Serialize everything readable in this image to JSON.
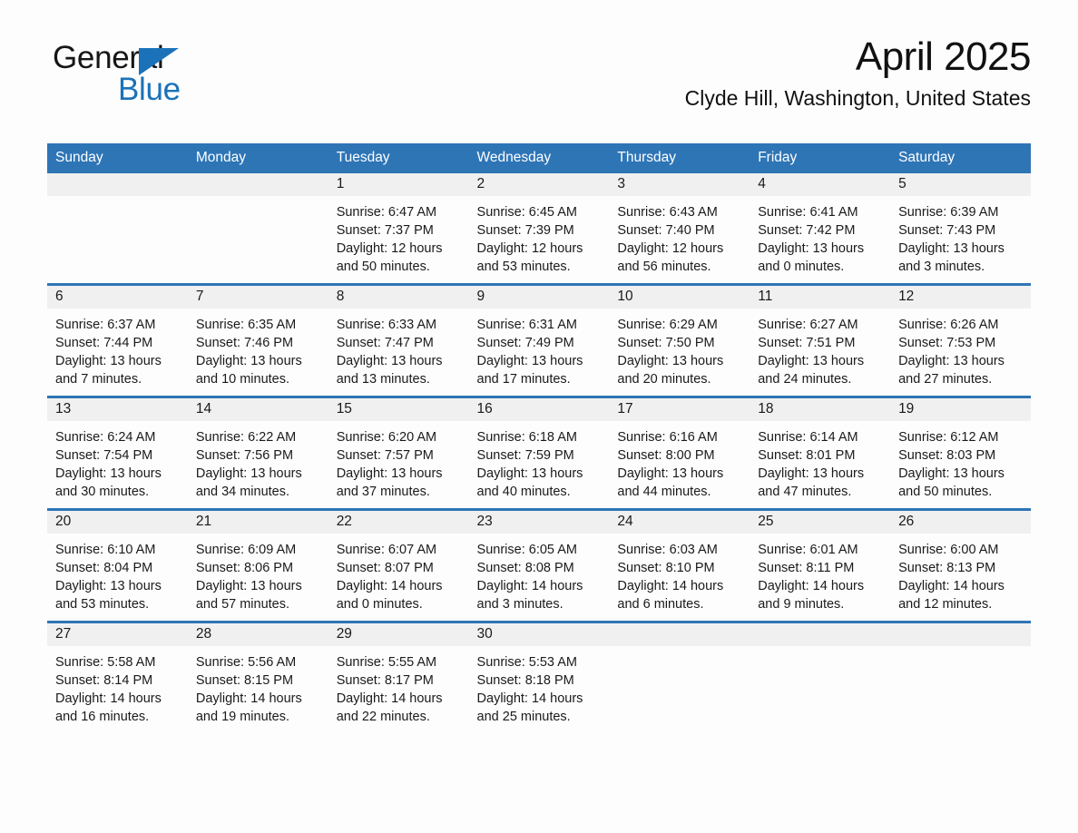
{
  "logo": {
    "word_one": "General",
    "word_two": "Blue",
    "triangle_icon": "triangle-icon",
    "accent_color": "#1b72b8"
  },
  "header": {
    "month_title": "April 2025",
    "location": "Clyde Hill, Washington, United States"
  },
  "theme": {
    "header_blue": "#2e75b6",
    "daynum_gray": "#f0f0f0",
    "page_background": "#fdfdfd",
    "text_color": "#1a1a1a"
  },
  "calendar": {
    "weekday_headers": [
      "Sunday",
      "Monday",
      "Tuesday",
      "Wednesday",
      "Thursday",
      "Friday",
      "Saturday"
    ],
    "weeks": [
      [
        {
          "day": "",
          "lines": []
        },
        {
          "day": "",
          "lines": []
        },
        {
          "day": "1",
          "lines": [
            "Sunrise: 6:47 AM",
            "Sunset: 7:37 PM",
            "Daylight: 12 hours",
            "and 50 minutes."
          ]
        },
        {
          "day": "2",
          "lines": [
            "Sunrise: 6:45 AM",
            "Sunset: 7:39 PM",
            "Daylight: 12 hours",
            "and 53 minutes."
          ]
        },
        {
          "day": "3",
          "lines": [
            "Sunrise: 6:43 AM",
            "Sunset: 7:40 PM",
            "Daylight: 12 hours",
            "and 56 minutes."
          ]
        },
        {
          "day": "4",
          "lines": [
            "Sunrise: 6:41 AM",
            "Sunset: 7:42 PM",
            "Daylight: 13 hours",
            "and 0 minutes."
          ]
        },
        {
          "day": "5",
          "lines": [
            "Sunrise: 6:39 AM",
            "Sunset: 7:43 PM",
            "Daylight: 13 hours",
            "and 3 minutes."
          ]
        }
      ],
      [
        {
          "day": "6",
          "lines": [
            "Sunrise: 6:37 AM",
            "Sunset: 7:44 PM",
            "Daylight: 13 hours",
            "and 7 minutes."
          ]
        },
        {
          "day": "7",
          "lines": [
            "Sunrise: 6:35 AM",
            "Sunset: 7:46 PM",
            "Daylight: 13 hours",
            "and 10 minutes."
          ]
        },
        {
          "day": "8",
          "lines": [
            "Sunrise: 6:33 AM",
            "Sunset: 7:47 PM",
            "Daylight: 13 hours",
            "and 13 minutes."
          ]
        },
        {
          "day": "9",
          "lines": [
            "Sunrise: 6:31 AM",
            "Sunset: 7:49 PM",
            "Daylight: 13 hours",
            "and 17 minutes."
          ]
        },
        {
          "day": "10",
          "lines": [
            "Sunrise: 6:29 AM",
            "Sunset: 7:50 PM",
            "Daylight: 13 hours",
            "and 20 minutes."
          ]
        },
        {
          "day": "11",
          "lines": [
            "Sunrise: 6:27 AM",
            "Sunset: 7:51 PM",
            "Daylight: 13 hours",
            "and 24 minutes."
          ]
        },
        {
          "day": "12",
          "lines": [
            "Sunrise: 6:26 AM",
            "Sunset: 7:53 PM",
            "Daylight: 13 hours",
            "and 27 minutes."
          ]
        }
      ],
      [
        {
          "day": "13",
          "lines": [
            "Sunrise: 6:24 AM",
            "Sunset: 7:54 PM",
            "Daylight: 13 hours",
            "and 30 minutes."
          ]
        },
        {
          "day": "14",
          "lines": [
            "Sunrise: 6:22 AM",
            "Sunset: 7:56 PM",
            "Daylight: 13 hours",
            "and 34 minutes."
          ]
        },
        {
          "day": "15",
          "lines": [
            "Sunrise: 6:20 AM",
            "Sunset: 7:57 PM",
            "Daylight: 13 hours",
            "and 37 minutes."
          ]
        },
        {
          "day": "16",
          "lines": [
            "Sunrise: 6:18 AM",
            "Sunset: 7:59 PM",
            "Daylight: 13 hours",
            "and 40 minutes."
          ]
        },
        {
          "day": "17",
          "lines": [
            "Sunrise: 6:16 AM",
            "Sunset: 8:00 PM",
            "Daylight: 13 hours",
            "and 44 minutes."
          ]
        },
        {
          "day": "18",
          "lines": [
            "Sunrise: 6:14 AM",
            "Sunset: 8:01 PM",
            "Daylight: 13 hours",
            "and 47 minutes."
          ]
        },
        {
          "day": "19",
          "lines": [
            "Sunrise: 6:12 AM",
            "Sunset: 8:03 PM",
            "Daylight: 13 hours",
            "and 50 minutes."
          ]
        }
      ],
      [
        {
          "day": "20",
          "lines": [
            "Sunrise: 6:10 AM",
            "Sunset: 8:04 PM",
            "Daylight: 13 hours",
            "and 53 minutes."
          ]
        },
        {
          "day": "21",
          "lines": [
            "Sunrise: 6:09 AM",
            "Sunset: 8:06 PM",
            "Daylight: 13 hours",
            "and 57 minutes."
          ]
        },
        {
          "day": "22",
          "lines": [
            "Sunrise: 6:07 AM",
            "Sunset: 8:07 PM",
            "Daylight: 14 hours",
            "and 0 minutes."
          ]
        },
        {
          "day": "23",
          "lines": [
            "Sunrise: 6:05 AM",
            "Sunset: 8:08 PM",
            "Daylight: 14 hours",
            "and 3 minutes."
          ]
        },
        {
          "day": "24",
          "lines": [
            "Sunrise: 6:03 AM",
            "Sunset: 8:10 PM",
            "Daylight: 14 hours",
            "and 6 minutes."
          ]
        },
        {
          "day": "25",
          "lines": [
            "Sunrise: 6:01 AM",
            "Sunset: 8:11 PM",
            "Daylight: 14 hours",
            "and 9 minutes."
          ]
        },
        {
          "day": "26",
          "lines": [
            "Sunrise: 6:00 AM",
            "Sunset: 8:13 PM",
            "Daylight: 14 hours",
            "and 12 minutes."
          ]
        }
      ],
      [
        {
          "day": "27",
          "lines": [
            "Sunrise: 5:58 AM",
            "Sunset: 8:14 PM",
            "Daylight: 14 hours",
            "and 16 minutes."
          ]
        },
        {
          "day": "28",
          "lines": [
            "Sunrise: 5:56 AM",
            "Sunset: 8:15 PM",
            "Daylight: 14 hours",
            "and 19 minutes."
          ]
        },
        {
          "day": "29",
          "lines": [
            "Sunrise: 5:55 AM",
            "Sunset: 8:17 PM",
            "Daylight: 14 hours",
            "and 22 minutes."
          ]
        },
        {
          "day": "30",
          "lines": [
            "Sunrise: 5:53 AM",
            "Sunset: 8:18 PM",
            "Daylight: 14 hours",
            "and 25 minutes."
          ]
        },
        {
          "day": "",
          "lines": []
        },
        {
          "day": "",
          "lines": []
        },
        {
          "day": "",
          "lines": []
        }
      ]
    ]
  }
}
